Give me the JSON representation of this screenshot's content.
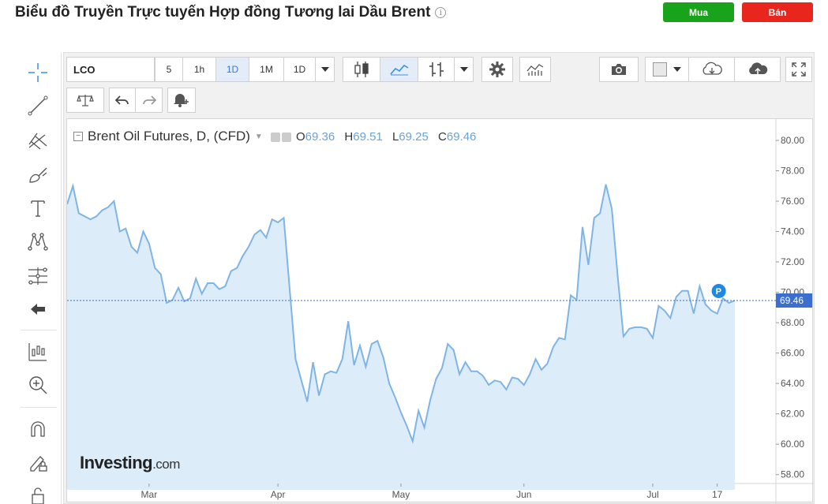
{
  "header": {
    "title": "Biểu đồ Truyền Trực tuyến Hợp đồng Tương lai Dầu Brent",
    "info_icon": "info-icon",
    "buy_label": "Mua",
    "sell_label": "Bán",
    "buy_color": "#18a31a",
    "sell_color": "#e8261e"
  },
  "toolbar": {
    "symbol": "LCO",
    "intervals": [
      "5",
      "1h",
      "1D",
      "1M",
      "1D"
    ],
    "active_interval": "1D"
  },
  "left_tools": [
    "crosshair-icon",
    "trend-line-icon",
    "pitchfork-icon",
    "brush-icon",
    "text-icon",
    "pattern-icon",
    "fib-icon",
    "back-arrow-icon",
    "indicators-icon",
    "zoom-icon",
    "magnet-icon",
    "lock-edit-icon",
    "lock-icon"
  ],
  "legend": {
    "name": "Brent Oil Futures, D, (CFD)",
    "open_label": "O",
    "open": "69.36",
    "high_label": "H",
    "high": "69.51",
    "low_label": "L",
    "low": "69.25",
    "close_label": "C",
    "close": "69.46"
  },
  "logo": {
    "brand": "Investing",
    "suffix": ".com"
  },
  "chart_data": {
    "type": "area",
    "series": [
      {
        "values": [
          75.8,
          77.0,
          75.2,
          75.0,
          74.8,
          75.0,
          75.4,
          75.6,
          76.0,
          74.0,
          74.2,
          73.0,
          72.6,
          74.0,
          73.2,
          71.6,
          71.2,
          69.3,
          69.5,
          70.3,
          69.4,
          69.6,
          70.9,
          69.9,
          70.6,
          70.6,
          70.2,
          70.4,
          71.4,
          71.6,
          72.4,
          73.0,
          73.8,
          74.1,
          73.6,
          74.8,
          74.6,
          74.9,
          70.2,
          65.6,
          64.2,
          62.8,
          65.4,
          63.2,
          64.6,
          64.8,
          64.7,
          65.6,
          68.1,
          65.2,
          66.5,
          65.1,
          66.6,
          66.8,
          65.7,
          64.0,
          63.1,
          62.1,
          61.2,
          60.2,
          62.2,
          61.1,
          62.9,
          64.3,
          65.0,
          66.6,
          66.2,
          64.6,
          65.4,
          64.8,
          64.8,
          64.5,
          63.9,
          64.2,
          64.1,
          63.6,
          64.4,
          64.3,
          63.9,
          64.6,
          65.6,
          64.9,
          65.3,
          66.4,
          67.0,
          66.9,
          69.8,
          69.5,
          74.3,
          71.8,
          74.9,
          75.2,
          77.1,
          75.5,
          71.1,
          67.1,
          67.6,
          67.7,
          67.7,
          67.6,
          67.0,
          69.1,
          68.8,
          68.3,
          69.7,
          70.1,
          70.1,
          68.6,
          70.4,
          69.2,
          68.8,
          68.6,
          69.6,
          69.3,
          69.46
        ]
      }
    ],
    "x_tick_labels": [
      "Mar",
      "Apr",
      "May",
      "Jun",
      "Jul",
      "17"
    ],
    "x_tick_index": [
      14,
      36,
      57,
      78,
      100,
      111
    ],
    "y_ticks": [
      "80.00",
      "78.00",
      "76.00",
      "74.00",
      "72.00",
      "70.00",
      "68.00",
      "66.00",
      "64.00",
      "62.00",
      "60.00",
      "58.00"
    ],
    "ylim": [
      57,
      81.4
    ],
    "last_price_label": "69.46",
    "last_price": 69.46,
    "marker_label": "P",
    "line_color": "#7fb4e6",
    "fill_color": "#dcedf9",
    "price_line_color": "#3a6fcf",
    "grid": false
  }
}
